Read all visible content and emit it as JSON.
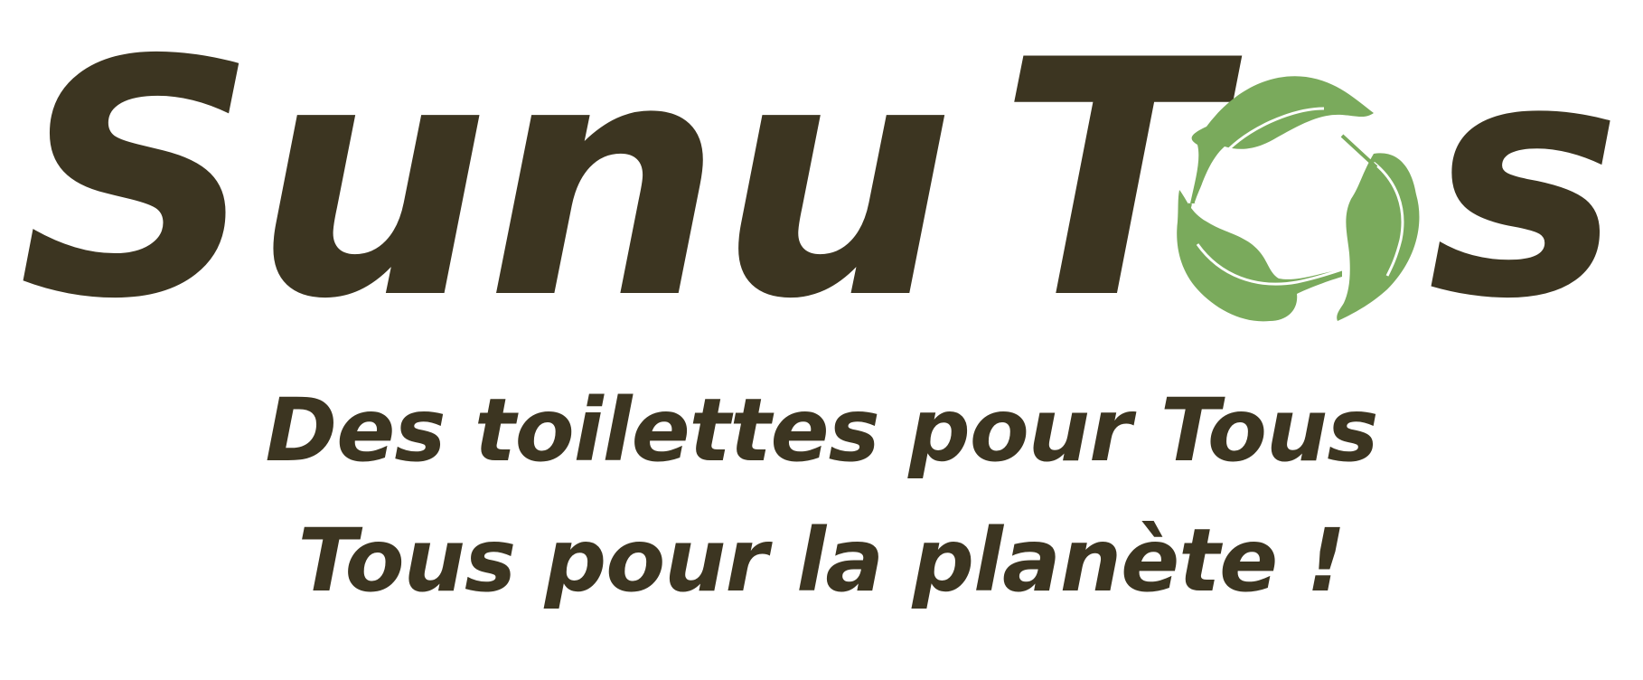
{
  "logo": {
    "brand_word_1": "Sunu",
    "brand_word_2_start": "T",
    "brand_word_2_end": "s",
    "recycle_symbol": "recycle-leaves-icon",
    "tagline_line_1": "Des toilettes pour Tous",
    "tagline_line_2": "Tous pour la planète !",
    "colors": {
      "text": "#3c3521",
      "leaf": "#7aaa5c",
      "background": "#ffffff"
    }
  }
}
